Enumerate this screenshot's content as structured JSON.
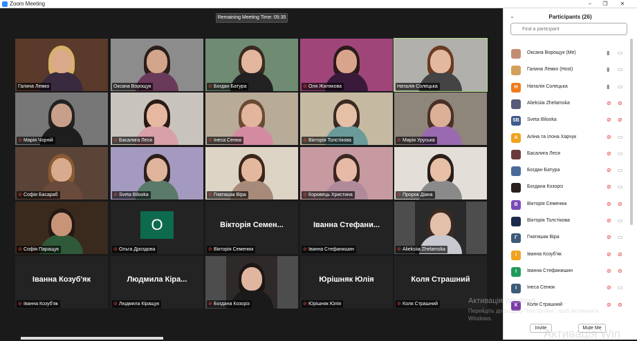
{
  "window": {
    "title": "Zoom Meeting",
    "minimize": "–",
    "maximize": "❐",
    "close": "✕"
  },
  "timer": "Remaining Meeting Time: 05:35",
  "tiles": [
    {
      "name": "Галина Лемко",
      "video": true,
      "muted": false,
      "bg": "#5a3a2a",
      "skin": "#d9a98a",
      "hair": "#d6b26a",
      "shirt": "#3a2a40"
    },
    {
      "name": "Оксана Ворощук",
      "video": true,
      "muted": false,
      "bg": "#8c8c8c",
      "skin": "#d2a58c",
      "hair": "#2b1e1a",
      "shirt": "#6a3a5a"
    },
    {
      "name": "Богдан Батура",
      "video": true,
      "muted": true,
      "bg": "#6f8b72",
      "skin": "#e2b79e",
      "hair": "#3a2a20",
      "shirt": "#222222"
    },
    {
      "name": "Оля Жилякова",
      "video": true,
      "muted": true,
      "bg": "#a0457a",
      "skin": "#d9a48c",
      "hair": "#2a1a18",
      "shirt": "#3a1a3a"
    },
    {
      "name": "Наталія Солецька",
      "video": true,
      "muted": false,
      "bg": "#b1b0ac",
      "skin": "#e2b89e",
      "hair": "#6a3a22",
      "shirt": "#444444"
    },
    {
      "name": "Марія Чорній",
      "video": true,
      "muted": true,
      "bg": "#777777",
      "skin": "#c89f8a",
      "hair": "#222222",
      "shirt": "#1e1e1e"
    },
    {
      "name": "Басалига Леся",
      "video": true,
      "muted": true,
      "bg": "#c9c3be",
      "skin": "#e6b8a0",
      "hair": "#2a1a14",
      "shirt": "#d8a0a8"
    },
    {
      "name": "Інеса Сенюк",
      "video": true,
      "muted": true,
      "bg": "#b8ab98",
      "skin": "#e2b69c",
      "hair": "#6a4a32",
      "shirt": "#d48aa0"
    },
    {
      "name": "Вікторія Толстікова",
      "video": true,
      "muted": true,
      "bg": "#c5b9a2",
      "skin": "#e5bfa6",
      "hair": "#3a2a22",
      "shirt": "#6a9a9a"
    },
    {
      "name": "Марія Уруська",
      "video": true,
      "muted": true,
      "bg": "#8e857b",
      "skin": "#dcb097",
      "hair": "#4a3026",
      "shirt": "#9a6ab0"
    },
    {
      "name": "Софія Басараб",
      "video": true,
      "muted": true,
      "bg": "#5a4438",
      "skin": "#d9ab8e",
      "hair": "#8a5a32",
      "shirt": "#6a4a3a"
    },
    {
      "name": "Sveta Bilooka",
      "video": true,
      "muted": true,
      "bg": "#a49ac0",
      "skin": "#e0b49c",
      "hair": "#2a1e1a",
      "shirt": "#5a7a6a"
    },
    {
      "name": "Гнатишак Віра",
      "video": true,
      "muted": true,
      "bg": "#ddd4c6",
      "skin": "#e4b89e",
      "hair": "#3a2618",
      "shirt": "#a88a7a"
    },
    {
      "name": "Коровець Христина",
      "video": true,
      "muted": true,
      "bg": "#c69aa0",
      "skin": "#e6baa6",
      "hair": "#3a2620",
      "shirt": "#b08a9a"
    },
    {
      "name": "Пророк Діана",
      "video": true,
      "muted": true,
      "bg": "#e3dfd8",
      "skin": "#e6bfa6",
      "hair": "#2a1e1a",
      "shirt": "#8a8a8a"
    },
    {
      "name": "Софія Паращук",
      "video": true,
      "muted": true,
      "bg": "#3a2a1e",
      "skin": "#c89478",
      "hair": "#241814",
      "shirt": "#2f5a3a"
    },
    {
      "name": "Ольга Дроздова",
      "video": false,
      "muted": true,
      "avatar": "О",
      "big": ""
    },
    {
      "name": "Вікторія Семенюк",
      "video": false,
      "muted": true,
      "big": "Вікторія Семен..."
    },
    {
      "name": "Іванна Стефанишин",
      "video": false,
      "muted": true,
      "big": "Іванна Стефани..."
    },
    {
      "name": "Alieksiia Zhelamska",
      "video": true,
      "muted": true,
      "bg": "#2a2a2a",
      "skin": "#e2c0aa",
      "hair": "#3a2a22",
      "shirt": "#c8c8d0",
      "small": true
    },
    {
      "name": "Іванна Козуб'як",
      "video": false,
      "muted": true,
      "big": "Іванна Козуб'як"
    },
    {
      "name": "Людмила Кіращук",
      "video": false,
      "muted": true,
      "big": "Людмила Кіра..."
    },
    {
      "name": "Богдана Козоріз",
      "video": true,
      "muted": true,
      "bg": "#2e2a2a",
      "skin": "#e0b6a0",
      "hair": "#1e1614",
      "shirt": "#1a1a1a",
      "small": true
    },
    {
      "name": "Юрішняк Юлія",
      "video": false,
      "muted": true,
      "big": "Юрішняк Юлія"
    },
    {
      "name": "Коля Страшний",
      "video": false,
      "muted": true,
      "big": "Коля Страшний"
    }
  ],
  "panel": {
    "title": "Participants (26)",
    "collapse": "⌄",
    "search_placeholder": "Find a participant",
    "participants": [
      {
        "name": "Оксана Ворощук (Me)",
        "avatar": "",
        "color": "#c48d72",
        "mic": "on",
        "cam": "on"
      },
      {
        "name": "Галина Лемко (Host)",
        "avatar": "",
        "color": "#d3a05c",
        "mic": "on",
        "cam": "on"
      },
      {
        "name": "Наталія Солецька",
        "avatar": "Н",
        "color": "#f07b1c",
        "mic": "on",
        "cam": "on"
      },
      {
        "name": "Alieksiia Zhelamska",
        "avatar": "",
        "color": "#5a5a7a",
        "mic": "off",
        "cam": "off"
      },
      {
        "name": "Sveta Bilooka",
        "avatar": "SB",
        "color": "#3d5a8a",
        "mic": "off",
        "cam": "off"
      },
      {
        "name": "Аліна та Ілона Харчук",
        "avatar": "А",
        "color": "#f0a21c",
        "mic": "off",
        "cam": "on"
      },
      {
        "name": "Басалига Леся",
        "avatar": "",
        "color": "#6a3a3a",
        "mic": "off",
        "cam": "on"
      },
      {
        "name": "Богдан Батура",
        "avatar": "",
        "color": "#4a6a9a",
        "mic": "off",
        "cam": "on"
      },
      {
        "name": "Богдана Козоріз",
        "avatar": "",
        "color": "#2a2020",
        "mic": "off",
        "cam": "on"
      },
      {
        "name": "Вікторія Семенюк",
        "avatar": "В",
        "color": "#7a4ab8",
        "mic": "off",
        "cam": "off"
      },
      {
        "name": "Вікторія Толстікова",
        "avatar": "",
        "color": "#1a2a4a",
        "mic": "off",
        "cam": "on"
      },
      {
        "name": "Гнатишак Віра",
        "avatar": "Г",
        "color": "#3d5a7a",
        "mic": "off",
        "cam": "on"
      },
      {
        "name": "Іванна Козуб'як",
        "avatar": "І",
        "color": "#f0a21c",
        "mic": "off",
        "cam": "off"
      },
      {
        "name": "Іванна Стефанишин",
        "avatar": "І",
        "color": "#1f9a5a",
        "mic": "off",
        "cam": "off"
      },
      {
        "name": "Інеса Сенюк",
        "avatar": "І",
        "color": "#3d5a7a",
        "mic": "off",
        "cam": "on"
      },
      {
        "name": "Коля Страшний",
        "avatar": "К",
        "color": "#7a3aa8",
        "mic": "off",
        "cam": "off"
      }
    ],
    "invite": "Invite",
    "mute_me": "Mute Me"
  },
  "watermark": {
    "line1": "Активація Windows",
    "line2": "Перейдіть до розділу \"Настройки\", щоб активувати",
    "line3": "Windows.",
    "big": "Активація Win"
  }
}
